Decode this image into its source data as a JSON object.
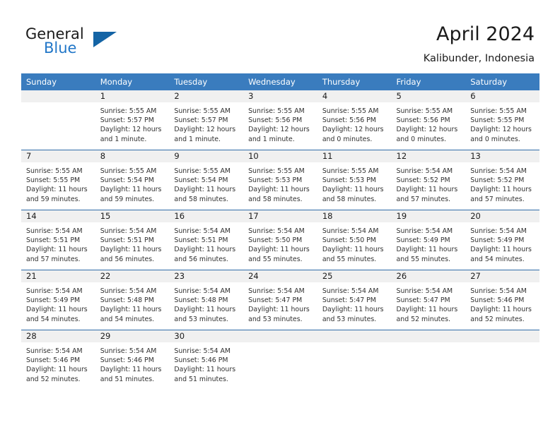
{
  "brand": {
    "word1": "General",
    "word2": "Blue",
    "triangle_color": "#1464a5",
    "blue_color": "#2277c8"
  },
  "header": {
    "month_title": "April 2024",
    "location": "Kalibunder, Indonesia"
  },
  "calendar": {
    "header_bg": "#3a7cbe",
    "daynum_bg": "#f0f0f0",
    "row_divider": "#2f6ca8",
    "weekday_headers": [
      "Sunday",
      "Monday",
      "Tuesday",
      "Wednesday",
      "Thursday",
      "Friday",
      "Saturday"
    ],
    "weeks": [
      [
        {
          "day": "",
          "empty": true
        },
        {
          "day": "1",
          "sunrise": "Sunrise: 5:55 AM",
          "sunset": "Sunset: 5:57 PM",
          "daylight_l1": "Daylight: 12 hours",
          "daylight_l2": "and 1 minute."
        },
        {
          "day": "2",
          "sunrise": "Sunrise: 5:55 AM",
          "sunset": "Sunset: 5:57 PM",
          "daylight_l1": "Daylight: 12 hours",
          "daylight_l2": "and 1 minute."
        },
        {
          "day": "3",
          "sunrise": "Sunrise: 5:55 AM",
          "sunset": "Sunset: 5:56 PM",
          "daylight_l1": "Daylight: 12 hours",
          "daylight_l2": "and 1 minute."
        },
        {
          "day": "4",
          "sunrise": "Sunrise: 5:55 AM",
          "sunset": "Sunset: 5:56 PM",
          "daylight_l1": "Daylight: 12 hours",
          "daylight_l2": "and 0 minutes."
        },
        {
          "day": "5",
          "sunrise": "Sunrise: 5:55 AM",
          "sunset": "Sunset: 5:56 PM",
          "daylight_l1": "Daylight: 12 hours",
          "daylight_l2": "and 0 minutes."
        },
        {
          "day": "6",
          "sunrise": "Sunrise: 5:55 AM",
          "sunset": "Sunset: 5:55 PM",
          "daylight_l1": "Daylight: 12 hours",
          "daylight_l2": "and 0 minutes."
        }
      ],
      [
        {
          "day": "7",
          "sunrise": "Sunrise: 5:55 AM",
          "sunset": "Sunset: 5:55 PM",
          "daylight_l1": "Daylight: 11 hours",
          "daylight_l2": "and 59 minutes."
        },
        {
          "day": "8",
          "sunrise": "Sunrise: 5:55 AM",
          "sunset": "Sunset: 5:54 PM",
          "daylight_l1": "Daylight: 11 hours",
          "daylight_l2": "and 59 minutes."
        },
        {
          "day": "9",
          "sunrise": "Sunrise: 5:55 AM",
          "sunset": "Sunset: 5:54 PM",
          "daylight_l1": "Daylight: 11 hours",
          "daylight_l2": "and 58 minutes."
        },
        {
          "day": "10",
          "sunrise": "Sunrise: 5:55 AM",
          "sunset": "Sunset: 5:53 PM",
          "daylight_l1": "Daylight: 11 hours",
          "daylight_l2": "and 58 minutes."
        },
        {
          "day": "11",
          "sunrise": "Sunrise: 5:55 AM",
          "sunset": "Sunset: 5:53 PM",
          "daylight_l1": "Daylight: 11 hours",
          "daylight_l2": "and 58 minutes."
        },
        {
          "day": "12",
          "sunrise": "Sunrise: 5:54 AM",
          "sunset": "Sunset: 5:52 PM",
          "daylight_l1": "Daylight: 11 hours",
          "daylight_l2": "and 57 minutes."
        },
        {
          "day": "13",
          "sunrise": "Sunrise: 5:54 AM",
          "sunset": "Sunset: 5:52 PM",
          "daylight_l1": "Daylight: 11 hours",
          "daylight_l2": "and 57 minutes."
        }
      ],
      [
        {
          "day": "14",
          "sunrise": "Sunrise: 5:54 AM",
          "sunset": "Sunset: 5:51 PM",
          "daylight_l1": "Daylight: 11 hours",
          "daylight_l2": "and 57 minutes."
        },
        {
          "day": "15",
          "sunrise": "Sunrise: 5:54 AM",
          "sunset": "Sunset: 5:51 PM",
          "daylight_l1": "Daylight: 11 hours",
          "daylight_l2": "and 56 minutes."
        },
        {
          "day": "16",
          "sunrise": "Sunrise: 5:54 AM",
          "sunset": "Sunset: 5:51 PM",
          "daylight_l1": "Daylight: 11 hours",
          "daylight_l2": "and 56 minutes."
        },
        {
          "day": "17",
          "sunrise": "Sunrise: 5:54 AM",
          "sunset": "Sunset: 5:50 PM",
          "daylight_l1": "Daylight: 11 hours",
          "daylight_l2": "and 55 minutes."
        },
        {
          "day": "18",
          "sunrise": "Sunrise: 5:54 AM",
          "sunset": "Sunset: 5:50 PM",
          "daylight_l1": "Daylight: 11 hours",
          "daylight_l2": "and 55 minutes."
        },
        {
          "day": "19",
          "sunrise": "Sunrise: 5:54 AM",
          "sunset": "Sunset: 5:49 PM",
          "daylight_l1": "Daylight: 11 hours",
          "daylight_l2": "and 55 minutes."
        },
        {
          "day": "20",
          "sunrise": "Sunrise: 5:54 AM",
          "sunset": "Sunset: 5:49 PM",
          "daylight_l1": "Daylight: 11 hours",
          "daylight_l2": "and 54 minutes."
        }
      ],
      [
        {
          "day": "21",
          "sunrise": "Sunrise: 5:54 AM",
          "sunset": "Sunset: 5:49 PM",
          "daylight_l1": "Daylight: 11 hours",
          "daylight_l2": "and 54 minutes."
        },
        {
          "day": "22",
          "sunrise": "Sunrise: 5:54 AM",
          "sunset": "Sunset: 5:48 PM",
          "daylight_l1": "Daylight: 11 hours",
          "daylight_l2": "and 54 minutes."
        },
        {
          "day": "23",
          "sunrise": "Sunrise: 5:54 AM",
          "sunset": "Sunset: 5:48 PM",
          "daylight_l1": "Daylight: 11 hours",
          "daylight_l2": "and 53 minutes."
        },
        {
          "day": "24",
          "sunrise": "Sunrise: 5:54 AM",
          "sunset": "Sunset: 5:47 PM",
          "daylight_l1": "Daylight: 11 hours",
          "daylight_l2": "and 53 minutes."
        },
        {
          "day": "25",
          "sunrise": "Sunrise: 5:54 AM",
          "sunset": "Sunset: 5:47 PM",
          "daylight_l1": "Daylight: 11 hours",
          "daylight_l2": "and 53 minutes."
        },
        {
          "day": "26",
          "sunrise": "Sunrise: 5:54 AM",
          "sunset": "Sunset: 5:47 PM",
          "daylight_l1": "Daylight: 11 hours",
          "daylight_l2": "and 52 minutes."
        },
        {
          "day": "27",
          "sunrise": "Sunrise: 5:54 AM",
          "sunset": "Sunset: 5:46 PM",
          "daylight_l1": "Daylight: 11 hours",
          "daylight_l2": "and 52 minutes."
        }
      ],
      [
        {
          "day": "28",
          "sunrise": "Sunrise: 5:54 AM",
          "sunset": "Sunset: 5:46 PM",
          "daylight_l1": "Daylight: 11 hours",
          "daylight_l2": "and 52 minutes."
        },
        {
          "day": "29",
          "sunrise": "Sunrise: 5:54 AM",
          "sunset": "Sunset: 5:46 PM",
          "daylight_l1": "Daylight: 11 hours",
          "daylight_l2": "and 51 minutes."
        },
        {
          "day": "30",
          "sunrise": "Sunrise: 5:54 AM",
          "sunset": "Sunset: 5:46 PM",
          "daylight_l1": "Daylight: 11 hours",
          "daylight_l2": "and 51 minutes."
        },
        {
          "day": "",
          "empty": true
        },
        {
          "day": "",
          "empty": true
        },
        {
          "day": "",
          "empty": true
        },
        {
          "day": "",
          "empty": true
        }
      ]
    ]
  }
}
